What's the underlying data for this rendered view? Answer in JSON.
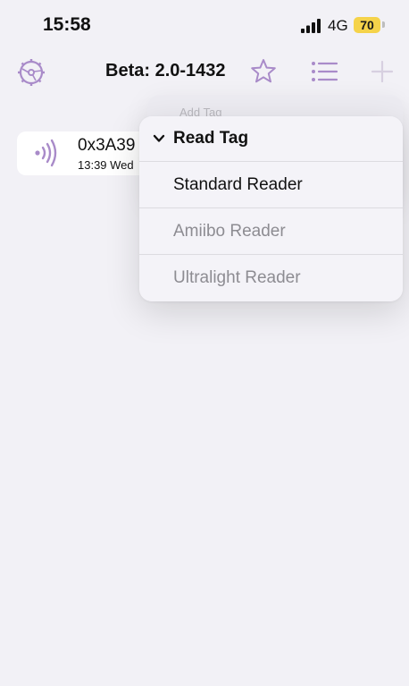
{
  "status_bar": {
    "time": "15:58",
    "network": "4G",
    "battery": "70",
    "battery_color": "#f5d34a"
  },
  "nav": {
    "title": "Beta: 2.0-1432",
    "accent": "#a98bc9",
    "icons": [
      "gear-icon",
      "star-icon",
      "list-icon",
      "plus-icon"
    ]
  },
  "tags": [
    {
      "id": "0x3A39",
      "time": "13:39 Wed",
      "icon": "nfc-signal-icon"
    }
  ],
  "menu_underlay": {
    "label": "Add Tag"
  },
  "menu": {
    "header": "Read Tag",
    "items": [
      {
        "label": "Standard Reader",
        "enabled": true
      },
      {
        "label": "Amiibo Reader",
        "enabled": false
      },
      {
        "label": "Ultralight Reader",
        "enabled": false
      }
    ]
  }
}
